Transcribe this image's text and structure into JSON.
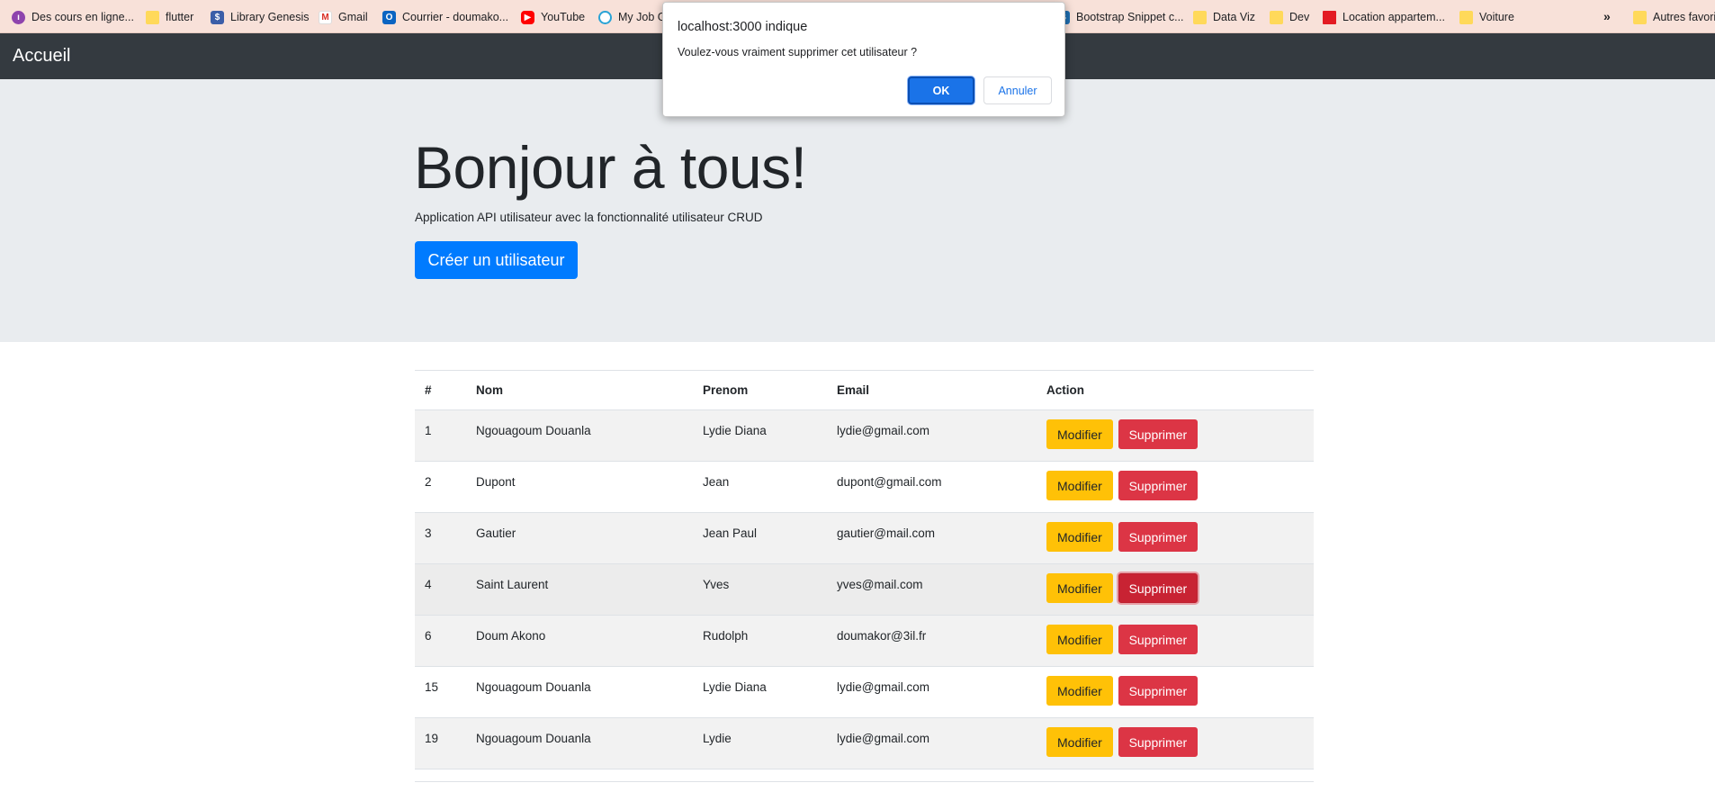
{
  "bookmarks": [
    {
      "label": "Des cours en ligne...",
      "icon": "online-courses-icon"
    },
    {
      "label": "flutter",
      "icon": "folder-icon"
    },
    {
      "label": "Library Genesis",
      "icon": "library-genesis-icon"
    },
    {
      "label": "Gmail",
      "icon": "gmail-icon"
    },
    {
      "label": "Courrier - doumako...",
      "icon": "outlook-icon"
    },
    {
      "label": "YouTube",
      "icon": "youtube-icon"
    },
    {
      "label": "My Job G",
      "icon": "jobs-icon"
    },
    {
      "label": "Bootstrap Snippet c...",
      "icon": "bootstrap-icon"
    },
    {
      "label": "Data Viz",
      "icon": "folder-icon"
    },
    {
      "label": "Dev",
      "icon": "folder-icon"
    },
    {
      "label": "Location appartem...",
      "icon": "red-square-icon"
    },
    {
      "label": "Voiture",
      "icon": "folder-icon"
    },
    {
      "label": "Autres favori",
      "icon": "folder-icon"
    }
  ],
  "bookmarks_overflow": "»",
  "navbar": {
    "brand": "Accueil"
  },
  "jumbotron": {
    "title": "Bonjour à tous!",
    "lead": "Application API utilisateur avec la fonctionnalité utilisateur CRUD",
    "create_button": "Créer un utilisateur"
  },
  "table": {
    "headers": [
      "#",
      "Nom",
      "Prenom",
      "Email",
      "Action"
    ],
    "rows": [
      {
        "id": "1",
        "nom": "Ngouagoum Douanla",
        "prenom": "Lydie Diana",
        "email": "lydie@gmail.com"
      },
      {
        "id": "2",
        "nom": "Dupont",
        "prenom": "Jean",
        "email": "dupont@gmail.com"
      },
      {
        "id": "3",
        "nom": "Gautier",
        "prenom": "Jean Paul",
        "email": "gautier@mail.com"
      },
      {
        "id": "4",
        "nom": "Saint Laurent",
        "prenom": "Yves",
        "email": "yves@mail.com"
      },
      {
        "id": "6",
        "nom": "Doum Akono",
        "prenom": "Rudolph",
        "email": "doumakor@3il.fr"
      },
      {
        "id": "15",
        "nom": "Ngouagoum Douanla",
        "prenom": "Lydie Diana",
        "email": "lydie@gmail.com"
      },
      {
        "id": "19",
        "nom": "Ngouagoum Douanla",
        "prenom": "Lydie",
        "email": "lydie@gmail.com"
      }
    ],
    "edit_label": "Modifier",
    "delete_label": "Supprimer"
  },
  "dialog": {
    "origin": "localhost:3000 indique",
    "message": "Voulez-vous vraiment supprimer cet utilisateur ?",
    "ok_label": "OK",
    "cancel_label": "Annuler"
  },
  "colors": {
    "navbar": "#343a40",
    "jumbotron": "#e9ecef",
    "primary": "#007bff",
    "warning": "#ffc107",
    "danger": "#dc3545"
  }
}
